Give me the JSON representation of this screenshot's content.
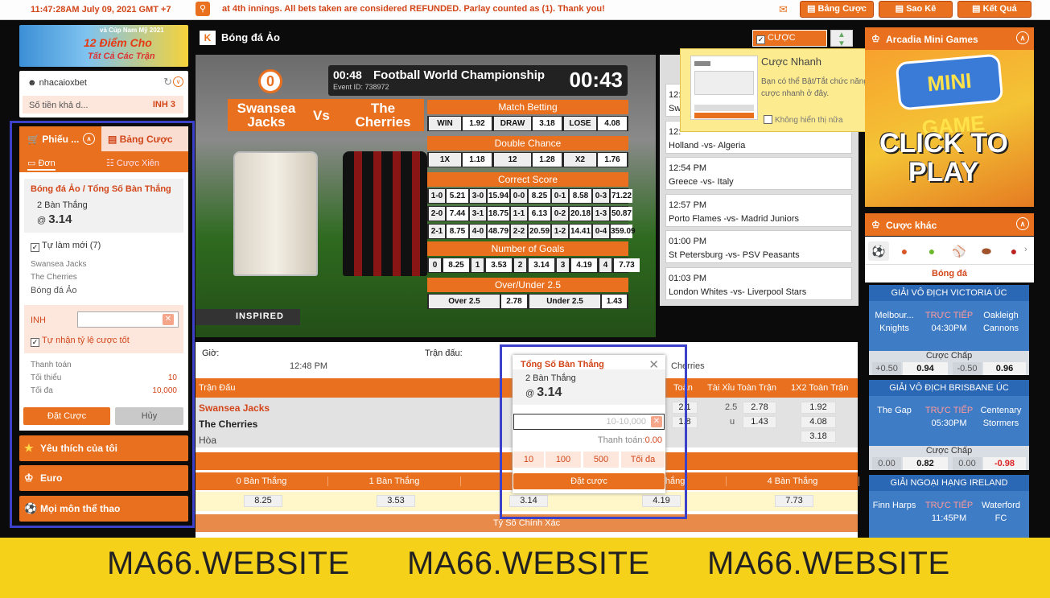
{
  "topbar": {
    "time": "11:47:28AM July 09, 2021 GMT +7",
    "ticker": "at 4th innings. All bets taken are considered REFUNDED. Parlay counted as (1). Thank you!",
    "buttons": [
      "Bảng Cược",
      "Sao Kê",
      "Kết Quả"
    ]
  },
  "banner": {
    "line1": "và Cúp Nam Mỹ 2021",
    "line2": "12 Điểm Cho",
    "line3": "Tất Cả Các Trận"
  },
  "account": {
    "username": "nhacaioxbet",
    "balance_label": "Số tiền khả d...",
    "balance_value": "INH 3"
  },
  "betslip": {
    "tab1": "Phiếu ...",
    "tab2": "Bảng Cược",
    "sub1": "Đơn",
    "sub2": "Cược Xiên",
    "market": "Bóng đá Ảo / Tổng Số Bàn Thắng",
    "selection": "2 Bàn Thắng",
    "at": "@",
    "odds": "3.14",
    "auto_refresh": "Tự làm mới (7)",
    "home": "Swansea Jacks",
    "away": "The Cherries",
    "sport": "Bóng đá Ảo",
    "currency": "INH",
    "accept_better": "Tự nhận tỷ lệ cược tốt",
    "payout_label": "Thanh toán",
    "min_label": "Tối thiểu",
    "min_value": "10",
    "max_label": "Tối đa",
    "max_value": "10,000",
    "place_btn": "Đặt Cược",
    "cancel_btn": "Hủy"
  },
  "leftmenu": [
    "Yêu thích của tôi",
    "Euro",
    "Mọi môn thể thao"
  ],
  "header": {
    "title": "Bóng đá Ảo",
    "quick_bet": "CƯỢC NHANH"
  },
  "video": {
    "time": "00:48",
    "title": "Football World Championship",
    "event": "Event ID: 738972",
    "clock": "00:43",
    "home": "Swansea Jacks",
    "vs": "Vs",
    "away": "The Cherries",
    "match_betting": "Match Betting",
    "mb": [
      "WIN",
      "1.92",
      "DRAW",
      "3.18",
      "LOSE",
      "4.08"
    ],
    "double_chance": "Double Chance",
    "dc": [
      "1X",
      "1.18",
      "12",
      "1.28",
      "X2",
      "1.76"
    ],
    "correct_score": "Correct Score",
    "cs": [
      [
        "1-0",
        "5.21",
        "3-0",
        "15.94",
        "0-0",
        "8.25",
        "0-1",
        "8.58",
        "0-3",
        "71.22"
      ],
      [
        "2-0",
        "7.44",
        "3-1",
        "18.75",
        "1-1",
        "6.13",
        "0-2",
        "20.18",
        "1-3",
        "50.87"
      ],
      [
        "2-1",
        "8.75",
        "4-0",
        "48.79",
        "2-2",
        "20.59",
        "1-2",
        "14.41",
        "0-4",
        "359.09"
      ]
    ],
    "goals_title": "Number of Goals",
    "goals": [
      "0",
      "8.25",
      "1",
      "3.53",
      "2",
      "3.14",
      "3",
      "4.19",
      "4",
      "7.73"
    ],
    "ou_title": "Over/Under 2.5",
    "ou": [
      "Over 2.5",
      "2.78",
      "Under 2.5",
      "1.43"
    ],
    "brand": "INSPIRED"
  },
  "matches": [
    {
      "time": "12:",
      "match": "Sw"
    },
    {
      "time": "12:",
      "match": "Holland -vs- Algeria"
    },
    {
      "time": "12:54 PM",
      "match": "Greece -vs- Italy"
    },
    {
      "time": "12:57 PM",
      "match": "Porto Flames -vs- Madrid Juniors"
    },
    {
      "time": "01:00 PM",
      "match": "St Petersburg -vs- PSV Peasants"
    },
    {
      "time": "01:03 PM",
      "match": "London Whites -vs- Liverpool Stars"
    }
  ],
  "table": {
    "time_label": "Giờ:",
    "time_value": "12:48 PM",
    "match_label": "Trận đấu:",
    "match_value": "Cherries",
    "col_match": "Trận Đấu",
    "col_toan": "Toàn",
    "col_ou": "Tài Xỉu Toàn Trận",
    "col_1x2": "1X2 Toàn Trận",
    "home": "Swansea Jacks",
    "away": "The Cherries",
    "draw": "Hòa",
    "hdp": [
      "2.1",
      "1.8"
    ],
    "ou_line": [
      "2.5",
      "u"
    ],
    "ou_odds": [
      "2.78",
      "1.43"
    ],
    "x12": [
      "1.92",
      "4.08",
      "3.18"
    ],
    "total_goals": "Tổng",
    "goal_cols": [
      "0 Bàn Thắng",
      "1 Bàn Thắng",
      "",
      "3 Bàn Thắng",
      "4 Bàn Thắng"
    ],
    "goal_odds": [
      "8.25",
      "3.53",
      "3.14",
      "4.19",
      "7.73"
    ],
    "correct_score": "Tỷ Số Chính Xác"
  },
  "popup": {
    "title": "Tổng Số Bàn Thắng",
    "selection": "2 Bàn Thắng",
    "at": "@",
    "odds": "3.14",
    "placeholder": "10-10,000",
    "payout": "Thanh toán:",
    "payout_value": "0.00",
    "quick": [
      "10",
      "100",
      "500",
      "Tối đa"
    ],
    "place": "Đặt cược"
  },
  "tooltip": {
    "title": "Cược Nhanh",
    "desc": "Bạn có thể Bật/Tắt chức năng cược nhanh ở đây.",
    "dont_show": "Không hiển thị nữa"
  },
  "right": {
    "games_title": "Arcadia Mini Games",
    "mini": "MINI GAME",
    "click": "CLICK TO",
    "play": "PLAY",
    "other_title": "Cược khác",
    "sport_label": "Bóng đá",
    "leagues": [
      {
        "name": "GIẢI VÔ ĐỊCH VICTORIA ÚC",
        "home": "Melbour... Knights",
        "live": "TRỰC TIẾP",
        "time": "04:30PM",
        "away": "Oakleigh Cannons",
        "hdp": "Cược Chấp",
        "o": [
          "+0.50",
          "0.94",
          "-0.50",
          "0.96"
        ]
      },
      {
        "name": "GIẢI VÔ ĐỊCH BRISBANE ÚC",
        "home": "The Gap",
        "live": "TRỰC TIẾP",
        "time": "05:30PM",
        "away": "Centenary Stormers",
        "hdp": "Cược Chấp",
        "o": [
          "0.00",
          "0.82",
          "0.00",
          "-0.98"
        ]
      },
      {
        "name": "GIẢI NGOẠI HẠNG IRELAND",
        "home": "Finn Harps",
        "live": "TRỰC TIẾP",
        "time": "11:45PM",
        "away": "Waterford FC"
      }
    ]
  },
  "watermark": [
    "MA66.WEBSITE",
    "MA66.WEBSITE",
    "MA66.WEBSITE"
  ]
}
